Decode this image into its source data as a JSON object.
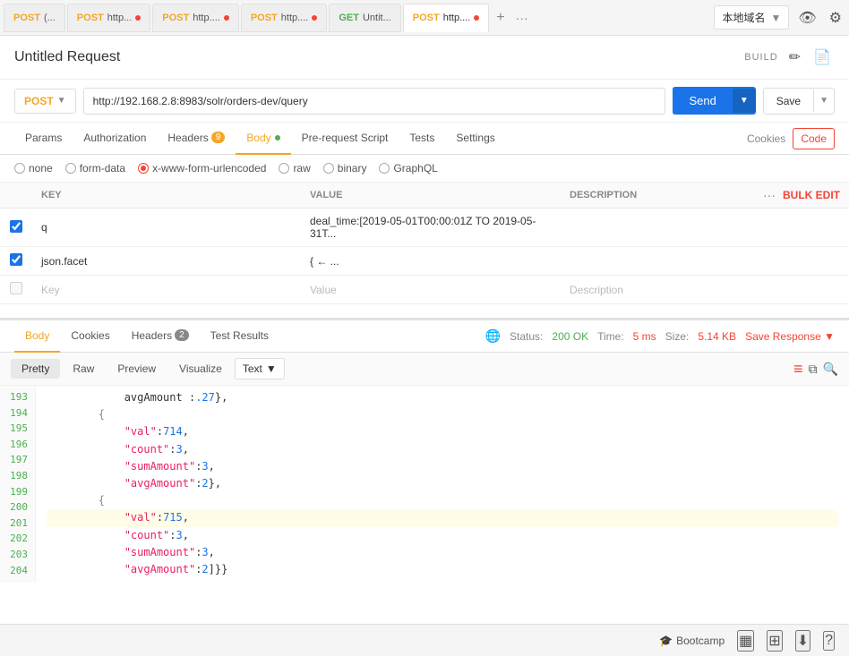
{
  "tabs": [
    {
      "method": "POST",
      "method_class": "post",
      "url": "(...",
      "has_dot": false,
      "active": false
    },
    {
      "method": "POST",
      "method_class": "post",
      "url": "http...",
      "has_dot": true,
      "active": false
    },
    {
      "method": "POST",
      "method_class": "post",
      "url": "http....",
      "has_dot": true,
      "active": false
    },
    {
      "method": "POST",
      "method_class": "post",
      "url": "http....",
      "has_dot": true,
      "active": false
    },
    {
      "method": "GET",
      "method_class": "get",
      "url": "Untit...",
      "has_dot": false,
      "active": false
    },
    {
      "method": "POST",
      "method_class": "post",
      "url": "http....",
      "has_dot": true,
      "active": true
    }
  ],
  "env_selector": "本地域名",
  "request_title": "Untitled Request",
  "build_label": "BUILD",
  "method": "POST",
  "url": "http://192.168.2.8:8983/solr/orders-dev/query",
  "send_label": "Send",
  "save_label": "Save",
  "nav_tabs": [
    {
      "label": "Params",
      "active": false,
      "badge": null
    },
    {
      "label": "Authorization",
      "active": false,
      "badge": null
    },
    {
      "label": "Headers",
      "active": false,
      "badge": "9",
      "badge_color": "default"
    },
    {
      "label": "Body",
      "active": true,
      "badge": null,
      "dot": true
    },
    {
      "label": "Pre-request Script",
      "active": false,
      "badge": null
    },
    {
      "label": "Tests",
      "active": false,
      "badge": null
    },
    {
      "label": "Settings",
      "active": false,
      "badge": null
    }
  ],
  "cookies_label": "Cookies",
  "code_label": "Code",
  "body_options": [
    {
      "label": "none",
      "selected": false
    },
    {
      "label": "form-data",
      "selected": false
    },
    {
      "label": "x-www-form-urlencoded",
      "selected": true
    },
    {
      "label": "raw",
      "selected": false
    },
    {
      "label": "binary",
      "selected": false
    },
    {
      "label": "GraphQL",
      "selected": false
    }
  ],
  "table_headers": {
    "key": "KEY",
    "value": "VALUE",
    "description": "DESCRIPTION"
  },
  "bulk_edit_label": "Bulk Edit",
  "table_rows": [
    {
      "checked": true,
      "key": "q",
      "value": "deal_time:[2019-05-01T00:00:01Z TO 2019-05-31T...",
      "description": ""
    },
    {
      "checked": true,
      "key": "json.facet",
      "value": "{ ← ...",
      "description": ""
    }
  ],
  "table_placeholder": {
    "key": "Key",
    "value": "Value",
    "description": "Description"
  },
  "response_tabs": [
    {
      "label": "Body",
      "active": true,
      "badge": null
    },
    {
      "label": "Cookies",
      "active": false,
      "badge": null
    },
    {
      "label": "Headers",
      "active": false,
      "badge": "2"
    },
    {
      "label": "Test Results",
      "active": false,
      "badge": null
    }
  ],
  "status": {
    "label": "Status:",
    "value": "200 OK",
    "time_label": "Time:",
    "time_value": "5 ms",
    "size_label": "Size:",
    "size_value": "5.14 KB"
  },
  "save_response_label": "Save Response",
  "resp_body_tabs": [
    {
      "label": "Pretty",
      "active": true
    },
    {
      "label": "Raw",
      "active": false
    },
    {
      "label": "Preview",
      "active": false
    },
    {
      "label": "Visualize",
      "active": false
    }
  ],
  "text_select": "Text",
  "code_lines": [
    {
      "num": "193",
      "content": "            avgAmount :.27},"
    },
    {
      "num": "194",
      "content": "        {"
    },
    {
      "num": "195",
      "content": "            \"val\":714,"
    },
    {
      "num": "196",
      "content": "            \"count\":3,"
    },
    {
      "num": "197",
      "content": "            \"sumAmount\":3,"
    },
    {
      "num": "198",
      "content": "            \"avgAmount\":2},"
    },
    {
      "num": "199",
      "content": "        {"
    },
    {
      "num": "200",
      "content": "            \"val\":715,"
    },
    {
      "num": "201",
      "content": "            \"count\":3,"
    },
    {
      "num": "202",
      "content": "            \"sumAmount\":3,"
    },
    {
      "num": "203",
      "content": "            \"avgAmount\":2}]}}"
    },
    {
      "num": "204",
      "content": ""
    }
  ],
  "bottom": {
    "bootcamp_label": "Bootcamp"
  }
}
